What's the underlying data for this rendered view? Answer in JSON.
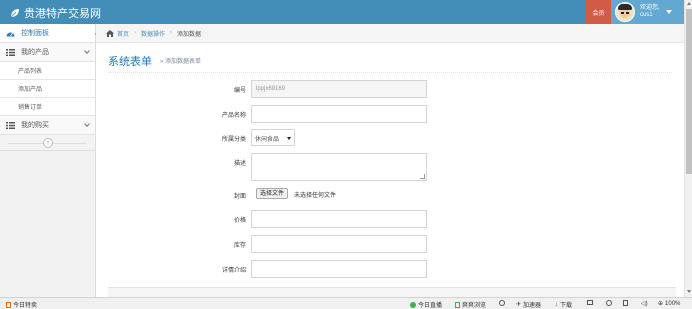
{
  "brand": {
    "title": "贵港特产交易网"
  },
  "header": {
    "member_badge": "会员",
    "welcome": "欢迎您,",
    "username": "cus1"
  },
  "sidebar": {
    "dashboard": "控制面板",
    "my_products": "我的产品",
    "product_list": "产品列表",
    "add_product": "添加产品",
    "sales_orders": "销售订单",
    "my_purchases": "我的购买",
    "collapse_symbol": "«"
  },
  "breadcrumb": {
    "home": "首页",
    "data_ops": "数据操作",
    "current": "添加数据",
    "separator": "›"
  },
  "page": {
    "title": "系统表单",
    "subtitle": "» 添加数据表单"
  },
  "form": {
    "code_label": "编号",
    "code_value": "lppjx69169",
    "name_label": "产品名称",
    "category_label": "所属分类",
    "category_value": "休闲食品",
    "desc_label": "描述",
    "cover_label": "封面",
    "file_button": "选择文件",
    "file_status": "未选择任何文件",
    "price_label": "价格",
    "stock_label": "库存",
    "detail_label": "详情介绍"
  },
  "statusbar": {
    "left": "今日特卖",
    "live": "今日直播",
    "browse": "爽爽浏览",
    "accelerator": "加速器",
    "download": "下载",
    "zoom": "100%"
  },
  "colors": {
    "navbar": "#438eb9",
    "member_badge": "#d15b47",
    "user_box": "#62a8d1",
    "title": "#2679b5"
  }
}
